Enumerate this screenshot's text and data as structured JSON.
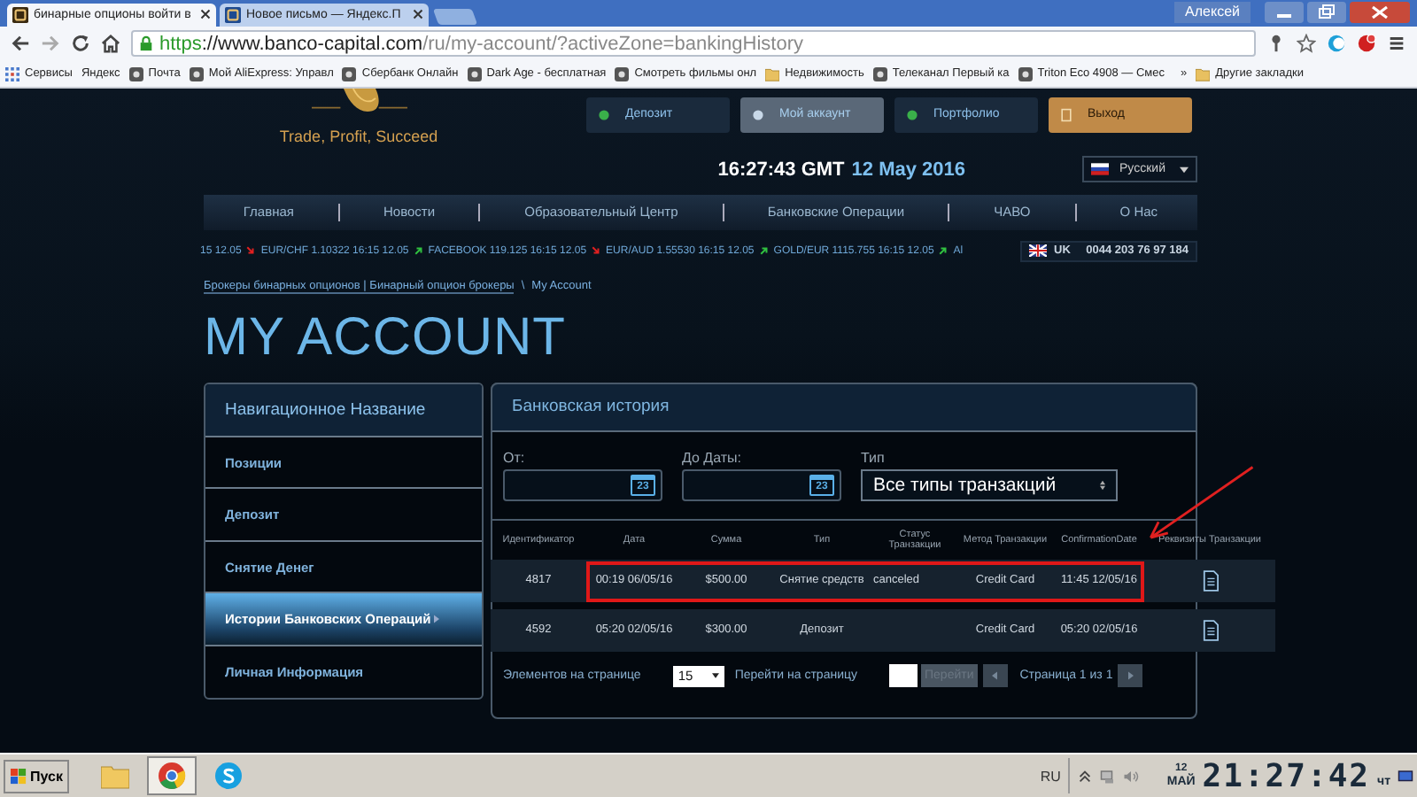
{
  "browser": {
    "tabs": [
      {
        "title": "бинарные опционы войти в",
        "selected": true
      },
      {
        "title": "Новое письмо — Яндекс.П",
        "selected": false
      }
    ],
    "user": "Алексей",
    "url": {
      "scheme": "https",
      "host": "://www.banco-capital.com",
      "path": "/ru/my-account/?activeZone=bankingHistory"
    },
    "bookmarks": [
      {
        "label": "Сервисы",
        "kind": "apps"
      },
      {
        "label": "Яндекс",
        "kind": "text"
      },
      {
        "label": "Почта",
        "kind": "site"
      },
      {
        "label": "Мой AliExpress: Управл",
        "kind": "site"
      },
      {
        "label": "Сбербанк Онлайн",
        "kind": "site"
      },
      {
        "label": "Dark Age - бесплатная",
        "kind": "site"
      },
      {
        "label": "Смотреть фильмы онл",
        "kind": "site"
      },
      {
        "label": "Недвижимость",
        "kind": "folder"
      },
      {
        "label": "Телеканал Первый ка",
        "kind": "site"
      },
      {
        "label": "Triton Eco 4908 — Смес",
        "kind": "site"
      }
    ],
    "bookmarks_more": "»",
    "other_bookmarks": "Другие закладки"
  },
  "site": {
    "tagline": "Trade, Profit, Succeed",
    "top_buttons": [
      {
        "label": "Депозит",
        "kind": "link",
        "selected": false
      },
      {
        "label": "Мой аккаунт",
        "kind": "link",
        "selected": true
      },
      {
        "label": "Портфолио",
        "kind": "link",
        "selected": false
      },
      {
        "label": "Выход",
        "kind": "exit",
        "selected": false
      }
    ],
    "time": "16:27:43 GMT",
    "date": "12 May 2016",
    "language": "Русский",
    "nav": [
      "Главная",
      "Новости",
      "Образовательный Центр",
      "Банковские Операции",
      "ЧАВО",
      "О Нас"
    ],
    "ticker": [
      {
        "text": "15 12.05",
        "rising": false
      },
      {
        "text": "EUR/CHF 1.10322 16:15 12.05",
        "rising": true
      },
      {
        "text": "FACEBOOK 119.125 16:15 12.05",
        "rising": false
      },
      {
        "text": "EUR/AUD 1.55530 16:15 12.05",
        "rising": true
      },
      {
        "text": "GOLD/EUR 1115.755 16:15 12.05",
        "rising": true
      },
      {
        "text": "Al"
      }
    ],
    "country": "UK",
    "phone": "0044 203 76 97 184",
    "breadcrumb": {
      "link": "Брокеры бинарных опционов | Бинарный опцион брокеры",
      "separator": "\\",
      "current": "My Account"
    },
    "title": "MY ACCOUNT",
    "sidebar": {
      "title": "Навигационное Название",
      "items": [
        {
          "label": "Позиции",
          "selected": false
        },
        {
          "label": "Депозит",
          "selected": false
        },
        {
          "label": "Снятие Денег",
          "selected": false
        },
        {
          "label": "Истории Банковских Операций",
          "selected": true
        },
        {
          "label": "Личная Информация",
          "selected": false
        }
      ]
    },
    "panel": {
      "title": "Банковская история",
      "date_fields": [
        {
          "label": "От:",
          "icon_text": "23"
        },
        {
          "label": "До Даты:",
          "icon_text": "23"
        }
      ],
      "type_label": "Тип",
      "type_value": "Все типы транзакций",
      "table": {
        "columns": [
          "Идентификатор",
          "Дата",
          "Сумма",
          "Тип",
          "Статус Транзакции",
          "Метод Транзакции",
          "ConfirmationDate",
          "Реквизиты Транзакции"
        ],
        "rows": [
          {
            "id": "4817",
            "date": "00:19 06/05/16",
            "amount": "$500.00",
            "type": "Снятие средств",
            "status": "canceled",
            "method": "Credit Card",
            "confirmation": "11:45 12/05/16",
            "highlighted": true
          },
          {
            "id": "4592",
            "date": "05:20 02/05/16",
            "amount": "$300.00",
            "type": "Депозит",
            "method": "Credit Card",
            "confirmation": "05:20 02/05/16",
            "highlighted": false
          }
        ]
      },
      "pager": {
        "per_page_label": "Элементов на странице",
        "per_page": "15",
        "goto_label": "Перейти на страницу",
        "goto_button": "Перейти",
        "page_info": "Страница 1 из 1"
      }
    }
  },
  "taskbar": {
    "start": "Пуск",
    "apps": [
      {
        "kind": "folder",
        "selected": false
      },
      {
        "kind": "chrome",
        "selected": true
      },
      {
        "kind": "skype",
        "selected": false
      }
    ],
    "language": "RU",
    "day": "12",
    "month": "МАЙ",
    "time": "21:27:42",
    "weekday": "чт"
  }
}
